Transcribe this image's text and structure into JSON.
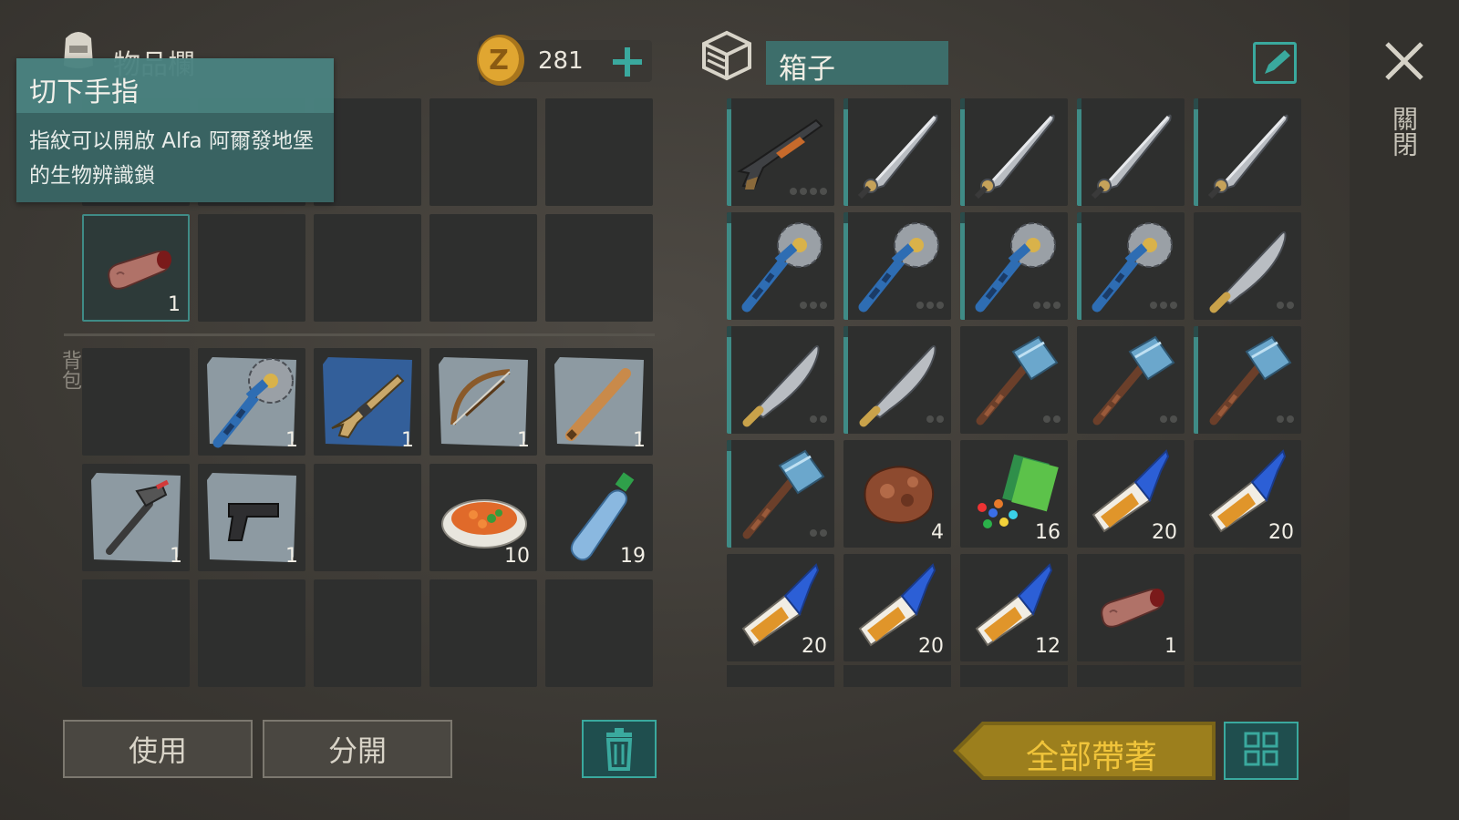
{
  "inventory": {
    "title": "物品欄",
    "backpack_label": "背包",
    "coins": "281",
    "slots_top": [
      {
        "item": "",
        "qty": ""
      },
      {
        "item": "",
        "qty": ""
      },
      {
        "item": "",
        "qty": ""
      },
      {
        "item": "",
        "qty": ""
      },
      {
        "item": "",
        "qty": ""
      },
      {
        "item": "finger",
        "qty": "1"
      },
      {
        "item": "",
        "qty": ""
      },
      {
        "item": "",
        "qty": ""
      },
      {
        "item": "",
        "qty": ""
      },
      {
        "item": "",
        "qty": ""
      }
    ],
    "slots_backpack": [
      {
        "item": "",
        "qty": ""
      },
      {
        "item": "saw-mace-blueprint",
        "qty": "1"
      },
      {
        "item": "rifle-blueprint",
        "qty": "1"
      },
      {
        "item": "bow-blueprint",
        "qty": "1"
      },
      {
        "item": "bat-blueprint",
        "qty": "1"
      },
      {
        "item": "hammer-blueprint",
        "qty": "1"
      },
      {
        "item": "pistol-blueprint",
        "qty": "1"
      },
      {
        "item": "",
        "qty": ""
      },
      {
        "item": "food-plate",
        "qty": "10"
      },
      {
        "item": "water-bottle",
        "qty": "19"
      }
    ]
  },
  "tooltip": {
    "title": "切下手指",
    "description": "指紋可以開啟 Alfa 阿爾發地堡的生物辨識鎖"
  },
  "container": {
    "title": "箱子",
    "slots": [
      {
        "item": "shotgun",
        "qty": "",
        "dots": 4,
        "dura": 0.9
      },
      {
        "item": "machete",
        "qty": "",
        "dots": 0,
        "dura": 0.9
      },
      {
        "item": "machete",
        "qty": "",
        "dots": 0,
        "dura": 0.9
      },
      {
        "item": "machete",
        "qty": "",
        "dots": 0,
        "dura": 0.9
      },
      {
        "item": "machete",
        "qty": "",
        "dots": 0,
        "dura": 0.9
      },
      {
        "item": "saw-mace",
        "qty": "",
        "dots": 3,
        "dura": 0.9
      },
      {
        "item": "saw-mace",
        "qty": "",
        "dots": 3,
        "dura": 0.9
      },
      {
        "item": "saw-mace",
        "qty": "",
        "dots": 3,
        "dura": 0.9
      },
      {
        "item": "saw-mace",
        "qty": "",
        "dots": 3,
        "dura": 0.9
      },
      {
        "item": "cleaver",
        "qty": "",
        "dots": 2,
        "dura": 0.0
      },
      {
        "item": "cleaver",
        "qty": "",
        "dots": 2,
        "dura": 0.9
      },
      {
        "item": "cleaver",
        "qty": "",
        "dots": 2,
        "dura": 0.9
      },
      {
        "item": "sledgehammer",
        "qty": "",
        "dots": 2,
        "dura": 0.0
      },
      {
        "item": "sledgehammer",
        "qty": "",
        "dots": 2,
        "dura": 0.0
      },
      {
        "item": "sledgehammer",
        "qty": "",
        "dots": 2,
        "dura": 0.9
      },
      {
        "item": "sledgehammer",
        "qty": "",
        "dots": 2,
        "dura": 0.9
      },
      {
        "item": "raw-meat",
        "qty": "4",
        "dots": 0,
        "dura": 0
      },
      {
        "item": "seeds-packet",
        "qty": "16",
        "dots": 0,
        "dura": 0
      },
      {
        "item": "super-glue",
        "qty": "20",
        "dots": 0,
        "dura": 0
      },
      {
        "item": "super-glue",
        "qty": "20",
        "dots": 0,
        "dura": 0
      },
      {
        "item": "super-glue",
        "qty": "20",
        "dots": 0,
        "dura": 0
      },
      {
        "item": "super-glue",
        "qty": "20",
        "dots": 0,
        "dura": 0
      },
      {
        "item": "super-glue",
        "qty": "12",
        "dots": 0,
        "dura": 0
      },
      {
        "item": "finger",
        "qty": "1",
        "dots": 0,
        "dura": 0
      },
      {
        "item": "",
        "qty": "",
        "dots": 0,
        "dura": 0
      }
    ]
  },
  "buttons": {
    "use": "使用",
    "split": "分開",
    "take_all": "全部帶著",
    "close": "關閉"
  },
  "colors": {
    "accent_teal": "#3f8b86",
    "gold": "#c9a537",
    "gold_text": "#f0c43a"
  }
}
